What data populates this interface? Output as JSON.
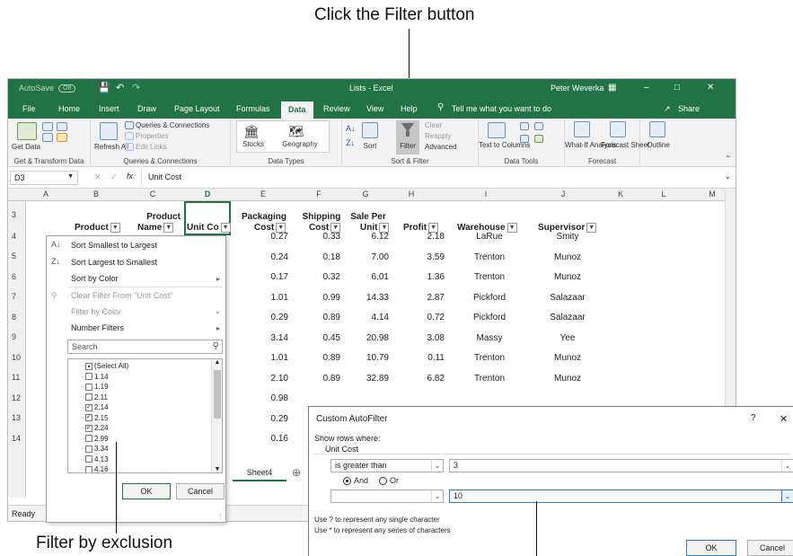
{
  "callouts": {
    "top": "Click the Filter button",
    "bottom": "Filter by exclusion"
  },
  "window": {
    "autosave": "AutoSave",
    "autosave_state": "Off",
    "title": "Lists - Excel",
    "user": "Peter Weverka",
    "minimize": "–",
    "maximize": "□",
    "close": "✕"
  },
  "tabs": [
    "File",
    "Home",
    "Insert",
    "Draw",
    "Page Layout",
    "Formulas",
    "Data",
    "Review",
    "View",
    "Help"
  ],
  "tellme": "Tell me what you want to do",
  "share": "Share",
  "ribbon": {
    "get_data": "Get Data",
    "get_transform": "Get & Transform Data",
    "refresh_all": "Refresh All",
    "queries_connections": "Queries & Connections",
    "properties": "Properties",
    "edit_links": "Edit Links",
    "queries_group": "Queries & Connections",
    "stocks": "Stocks",
    "geography": "Geography",
    "data_types": "Data Types",
    "sort_az": "A↓Z",
    "sort": "Sort",
    "filter": "Filter",
    "clear": "Clear",
    "reapply": "Reapply",
    "advanced": "Advanced",
    "sort_filter": "Sort & Filter",
    "text_to_columns": "Text to Columns",
    "data_tools": "Data Tools",
    "what_if": "What-If Analysis",
    "forecast_sheet": "Forecast Sheet",
    "forecast_group": "Forecast",
    "outline": "Outline"
  },
  "formula_bar": {
    "name_box": "D3",
    "fx": "fx",
    "content": "Unit Cost"
  },
  "columns": [
    "A",
    "B",
    "C",
    "D",
    "E",
    "F",
    "G",
    "H",
    "I",
    "J",
    "K",
    "L",
    "M"
  ],
  "rows": [
    "3",
    "4",
    "5",
    "6",
    "7",
    "8",
    "9",
    "10",
    "11",
    "12",
    "13",
    "14"
  ],
  "headers": {
    "product": "Product",
    "product_name_1": "Product",
    "product_name_2": "Name",
    "unit_cost": "Unit Co",
    "packaging_1": "Packaging",
    "packaging_2": "Cost",
    "shipping_1": "Shipping",
    "shipping_2": "Cost",
    "saleper_1": "Sale Per",
    "saleper_2": "Unit",
    "profit": "Profit",
    "warehouse": "Warehouse",
    "supervisor": "Supervisor"
  },
  "table": [
    {
      "packaging": "0.27",
      "shipping": "0.33",
      "sale": "6.12",
      "profit": "2.18",
      "warehouse": "LaRue",
      "supervisor": "Smity"
    },
    {
      "packaging": "0.24",
      "shipping": "0.18",
      "sale": "7.00",
      "profit": "3.59",
      "warehouse": "Trenton",
      "supervisor": "Munoz"
    },
    {
      "packaging": "0.17",
      "shipping": "0.32",
      "sale": "6.01",
      "profit": "1.36",
      "warehouse": "Trenton",
      "supervisor": "Munoz"
    },
    {
      "packaging": "1.01",
      "shipping": "0.99",
      "sale": "14.33",
      "profit": "2.87",
      "warehouse": "Pickford",
      "supervisor": "Salazaar"
    },
    {
      "packaging": "0.29",
      "shipping": "0.89",
      "sale": "4.14",
      "profit": "0.72",
      "warehouse": "Pickford",
      "supervisor": "Salazaar"
    },
    {
      "packaging": "3.14",
      "shipping": "0.45",
      "sale": "20.98",
      "profit": "3.08",
      "warehouse": "Massy",
      "supervisor": "Yee"
    },
    {
      "packaging": "1.01",
      "shipping": "0.89",
      "sale": "10.79",
      "profit": "0.11",
      "warehouse": "Trenton",
      "supervisor": "Munoz"
    },
    {
      "packaging": "2.10",
      "shipping": "0.89",
      "sale": "32.89",
      "profit": "6.82",
      "warehouse": "Trenton",
      "supervisor": "Munoz"
    },
    {
      "packaging": "0.98"
    },
    {
      "packaging": "0.29"
    },
    {
      "packaging": "0.16"
    }
  ],
  "filter_menu": {
    "sort_small": "Sort Smallest to Largest",
    "sort_large": "Sort Largest to Smallest",
    "sort_color": "Sort by Color",
    "clear_filter": "Clear Filter From \"Unit Cost\"",
    "filter_color": "Filter by Color",
    "number_filters": "Number Filters",
    "search_placeholder": "Search",
    "items": [
      {
        "label": "(Select All)",
        "state": "partial"
      },
      {
        "label": "1.14",
        "state": "unchecked"
      },
      {
        "label": "1.19",
        "state": "unchecked"
      },
      {
        "label": "2.11",
        "state": "unchecked"
      },
      {
        "label": "2.14",
        "state": "checked"
      },
      {
        "label": "2.15",
        "state": "checked"
      },
      {
        "label": "2.24",
        "state": "checked"
      },
      {
        "label": "2.99",
        "state": "unchecked"
      },
      {
        "label": "3.34",
        "state": "unchecked"
      },
      {
        "label": "4.13",
        "state": "unchecked"
      },
      {
        "label": "4.16",
        "state": "unchecked"
      }
    ],
    "ok": "OK",
    "cancel": "Cancel"
  },
  "sheet_tab": "Sheet4",
  "status": "Ready",
  "custom_dialog": {
    "title": "Custom AutoFilter",
    "help": "?",
    "close": "✕",
    "show_rows": "Show rows where:",
    "field": "Unit Cost",
    "op1": "is greater than",
    "val1": "3",
    "and": "And",
    "or": "Or",
    "op2": "",
    "val2": "10",
    "hint1": "Use ? to represent any single character",
    "hint2": "Use * to represent any series of characters",
    "ok": "OK",
    "cancel": "Cancel"
  }
}
